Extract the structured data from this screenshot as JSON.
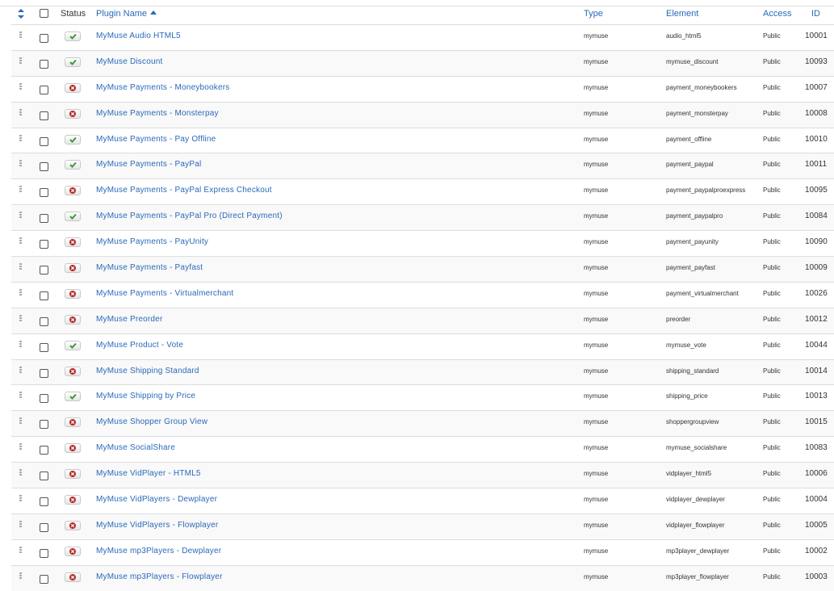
{
  "header": {
    "status": "Status",
    "plugin_name": "Plugin Name",
    "type": "Type",
    "element": "Element",
    "access": "Access",
    "id": "ID"
  },
  "colors": {
    "link": "#2a69b8",
    "enabled": "#3a9a3a",
    "disabled": "#b52b27"
  },
  "rows": [
    {
      "name": "MyMuse Audio HTML5",
      "enabled": true,
      "type": "mymuse",
      "element": "audio_html5",
      "access": "Public",
      "id": "10001"
    },
    {
      "name": "MyMuse Discount",
      "enabled": true,
      "type": "mymuse",
      "element": "mymuse_discount",
      "access": "Public",
      "id": "10093"
    },
    {
      "name": "MyMuse Payments - Moneybookers",
      "enabled": false,
      "type": "mymuse",
      "element": "payment_moneybookers",
      "access": "Public",
      "id": "10007"
    },
    {
      "name": "MyMuse Payments - Monsterpay",
      "enabled": false,
      "type": "mymuse",
      "element": "payment_monsterpay",
      "access": "Public",
      "id": "10008"
    },
    {
      "name": "MyMuse Payments - Pay Offline",
      "enabled": true,
      "type": "mymuse",
      "element": "payment_offline",
      "access": "Public",
      "id": "10010"
    },
    {
      "name": "MyMuse Payments - PayPal",
      "enabled": true,
      "type": "mymuse",
      "element": "payment_paypal",
      "access": "Public",
      "id": "10011"
    },
    {
      "name": "MyMuse Payments - PayPal Express Checkout",
      "enabled": false,
      "type": "mymuse",
      "element": "payment_paypalproexpress",
      "access": "Public",
      "id": "10095"
    },
    {
      "name": "MyMuse Payments - PayPal Pro (Direct Payment)",
      "enabled": true,
      "type": "mymuse",
      "element": "payment_paypalpro",
      "access": "Public",
      "id": "10084"
    },
    {
      "name": "MyMuse Payments - PayUnity",
      "enabled": false,
      "type": "mymuse",
      "element": "payment_payunity",
      "access": "Public",
      "id": "10090"
    },
    {
      "name": "MyMuse Payments - Payfast",
      "enabled": false,
      "type": "mymuse",
      "element": "payment_payfast",
      "access": "Public",
      "id": "10009"
    },
    {
      "name": "MyMuse Payments - Virtualmerchant",
      "enabled": false,
      "type": "mymuse",
      "element": "payment_virtualmerchant",
      "access": "Public",
      "id": "10026"
    },
    {
      "name": "MyMuse Preorder",
      "enabled": false,
      "type": "mymuse",
      "element": "preorder",
      "access": "Public",
      "id": "10012"
    },
    {
      "name": "MyMuse Product - Vote",
      "enabled": true,
      "type": "mymuse",
      "element": "mymuse_vote",
      "access": "Public",
      "id": "10044"
    },
    {
      "name": "MyMuse Shipping Standard",
      "enabled": false,
      "type": "mymuse",
      "element": "shipping_standard",
      "access": "Public",
      "id": "10014"
    },
    {
      "name": "MyMuse Shipping by Price",
      "enabled": true,
      "type": "mymuse",
      "element": "shipping_price",
      "access": "Public",
      "id": "10013"
    },
    {
      "name": "MyMuse Shopper Group View",
      "enabled": false,
      "type": "mymuse",
      "element": "shoppergroupview",
      "access": "Public",
      "id": "10015"
    },
    {
      "name": "MyMuse SocialShare",
      "enabled": false,
      "type": "mymuse",
      "element": "mymuse_socialshare",
      "access": "Public",
      "id": "10083"
    },
    {
      "name": "MyMuse VidPlayer - HTML5",
      "enabled": false,
      "type": "mymuse",
      "element": "vidplayer_html5",
      "access": "Public",
      "id": "10006"
    },
    {
      "name": "MyMuse VidPlayers - Dewplayer",
      "enabled": false,
      "type": "mymuse",
      "element": "vidplayer_dewplayer",
      "access": "Public",
      "id": "10004"
    },
    {
      "name": "MyMuse VidPlayers - Flowplayer",
      "enabled": false,
      "type": "mymuse",
      "element": "vidplayer_flowplayer",
      "access": "Public",
      "id": "10005"
    },
    {
      "name": "MyMuse mp3Players - Dewplayer",
      "enabled": false,
      "type": "mymuse",
      "element": "mp3player_dewplayer",
      "access": "Public",
      "id": "10002"
    },
    {
      "name": "MyMuse mp3Players - Flowplayer",
      "enabled": false,
      "type": "mymuse",
      "element": "mp3player_flowplayer",
      "access": "Public",
      "id": "10003"
    }
  ]
}
